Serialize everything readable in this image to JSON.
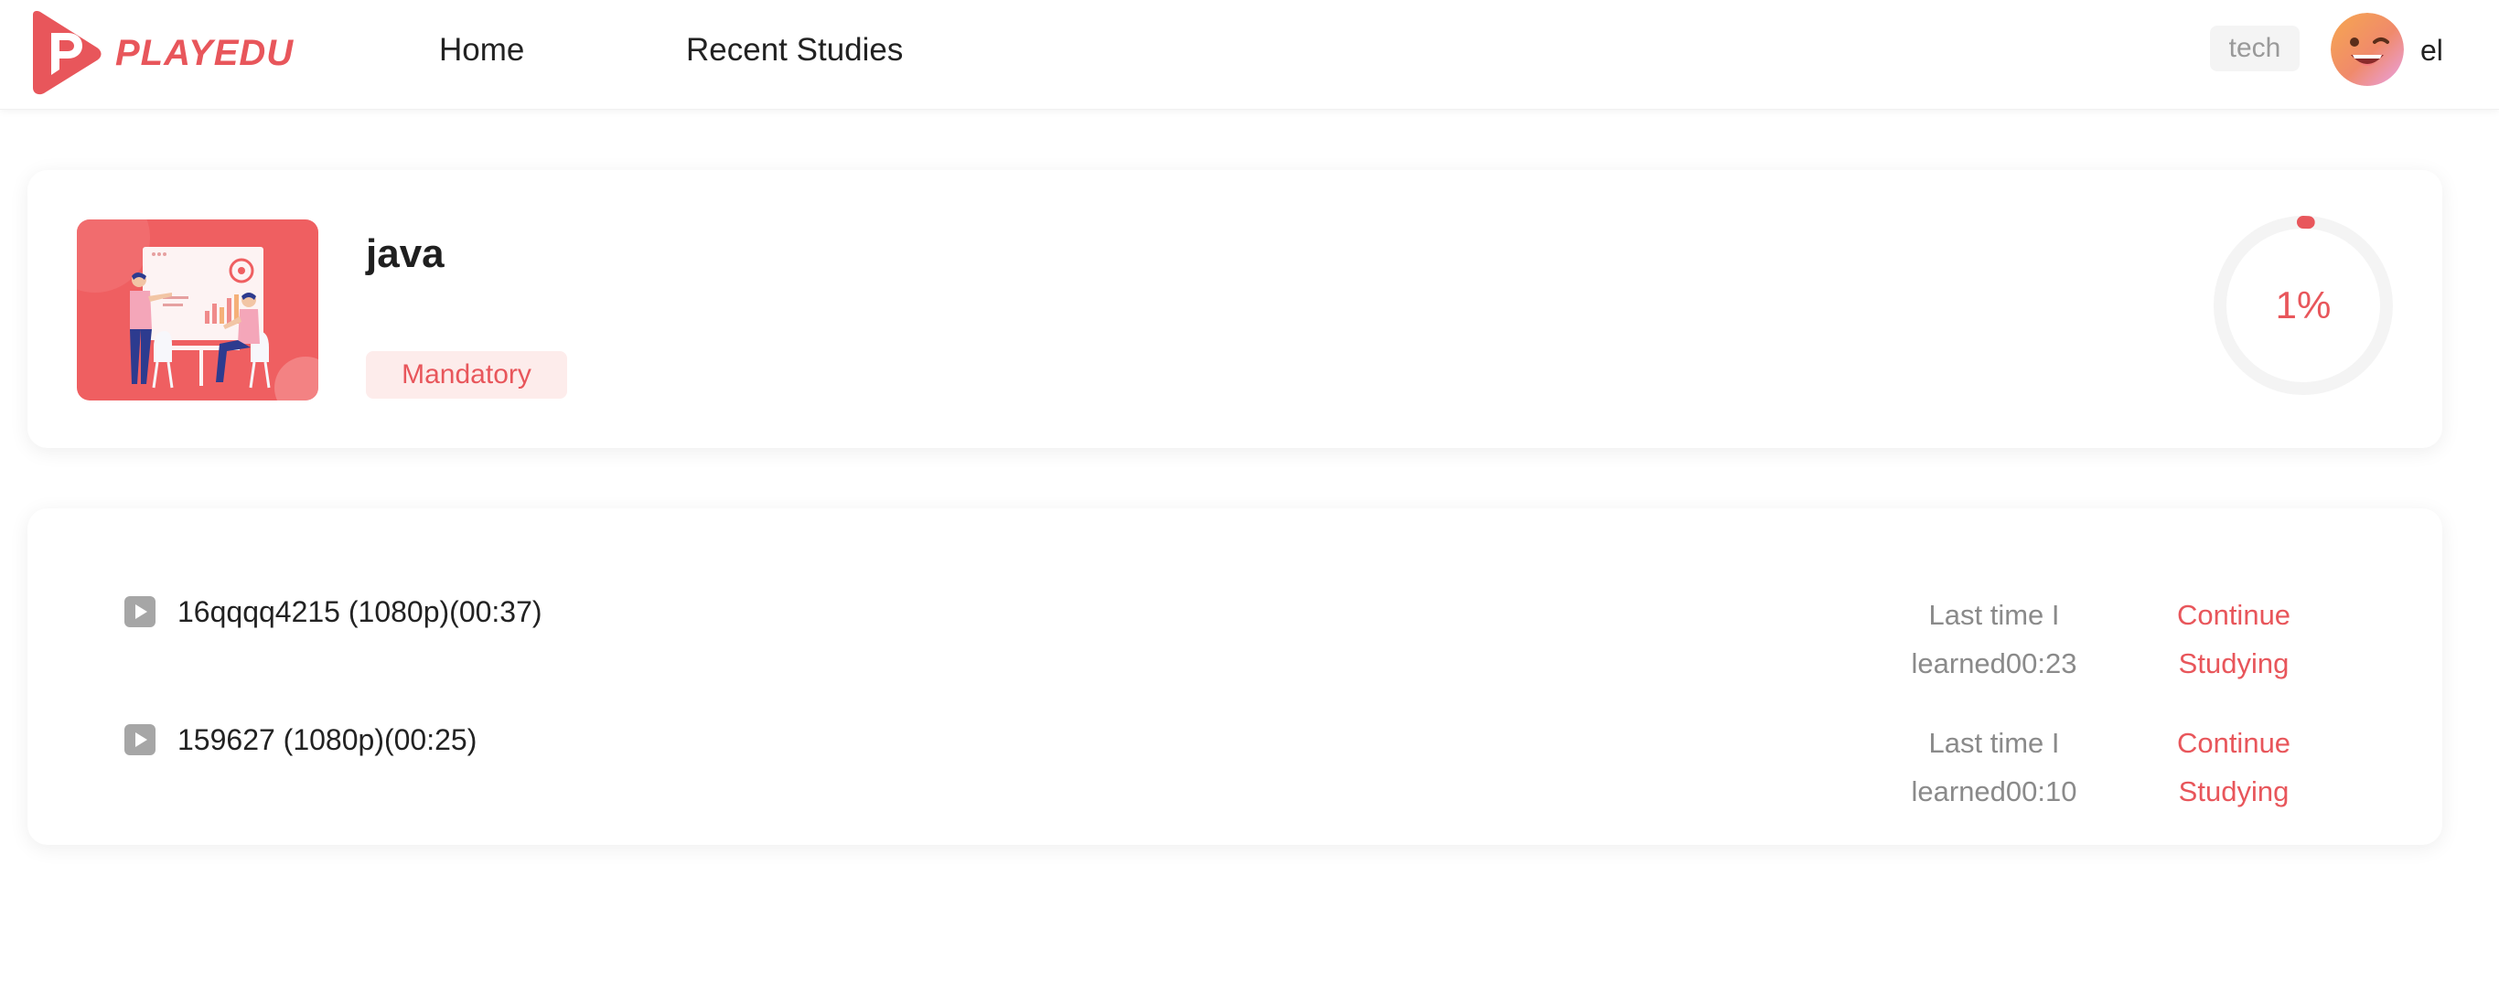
{
  "brand": {
    "name": "PLAYEDU",
    "accent_color": "#e8565b"
  },
  "nav": {
    "items": [
      {
        "label": "Home"
      },
      {
        "label": "Recent Studies"
      }
    ]
  },
  "user": {
    "department": "tech",
    "name": "el",
    "avatar_icon": "smiley-avatar"
  },
  "course": {
    "title": "java",
    "type_badge": "Mandatory",
    "progress_percent": 1,
    "progress_label": "1%",
    "thumbnail_icon": "presentation-illustration"
  },
  "chapters": [
    {
      "title": "16qqqq4215 (1080p)(00:37)",
      "last_time_line1": "Last time I",
      "last_time_line2": "learned00:23",
      "action_line1": "Continue",
      "action_line2": "Studying",
      "icon": "play-icon"
    },
    {
      "title": "159627 (1080p)(00:25)",
      "last_time_line1": "Last time I",
      "last_time_line2": "learned00:10",
      "action_line1": "Continue",
      "action_line2": "Studying",
      "icon": "play-icon"
    }
  ]
}
